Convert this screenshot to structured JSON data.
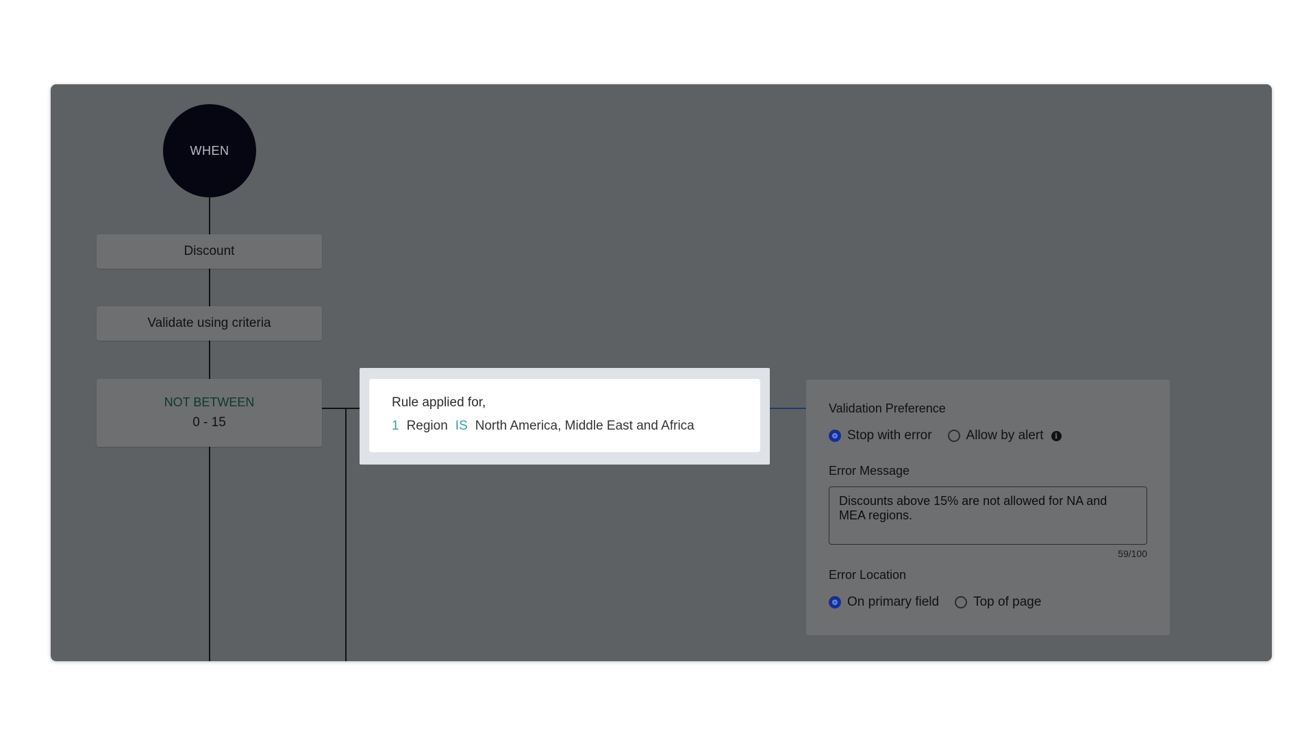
{
  "flow": {
    "start_label": "WHEN",
    "field_node": "Discount",
    "validate_node": "Validate using criteria",
    "criteria_operator": "NOT BETWEEN",
    "criteria_range": "0 - 15"
  },
  "rule": {
    "title": "Rule applied for,",
    "index": "1",
    "field": "Region",
    "condition": "IS",
    "value": "North America, Middle East and Africa"
  },
  "validation": {
    "preference_label": "Validation Preference",
    "preference_options": [
      "Stop with error",
      "Allow by alert"
    ],
    "preference_selected": "Stop with error",
    "info_icon": "info-icon",
    "error_message_label": "Error Message",
    "error_message": "Discounts above 15% are not allowed for NA and MEA regions.",
    "char_count": "59/100",
    "error_location_label": "Error Location",
    "location_options": [
      "On primary field",
      "Top of page"
    ],
    "location_selected": "On primary field"
  },
  "colors": {
    "canvas": "#5e6164",
    "node": "#6e6f71",
    "radio_selected": "#1a2d8f",
    "condition_teal": "#2aa6a2",
    "operator_green": "#0c3a26"
  }
}
